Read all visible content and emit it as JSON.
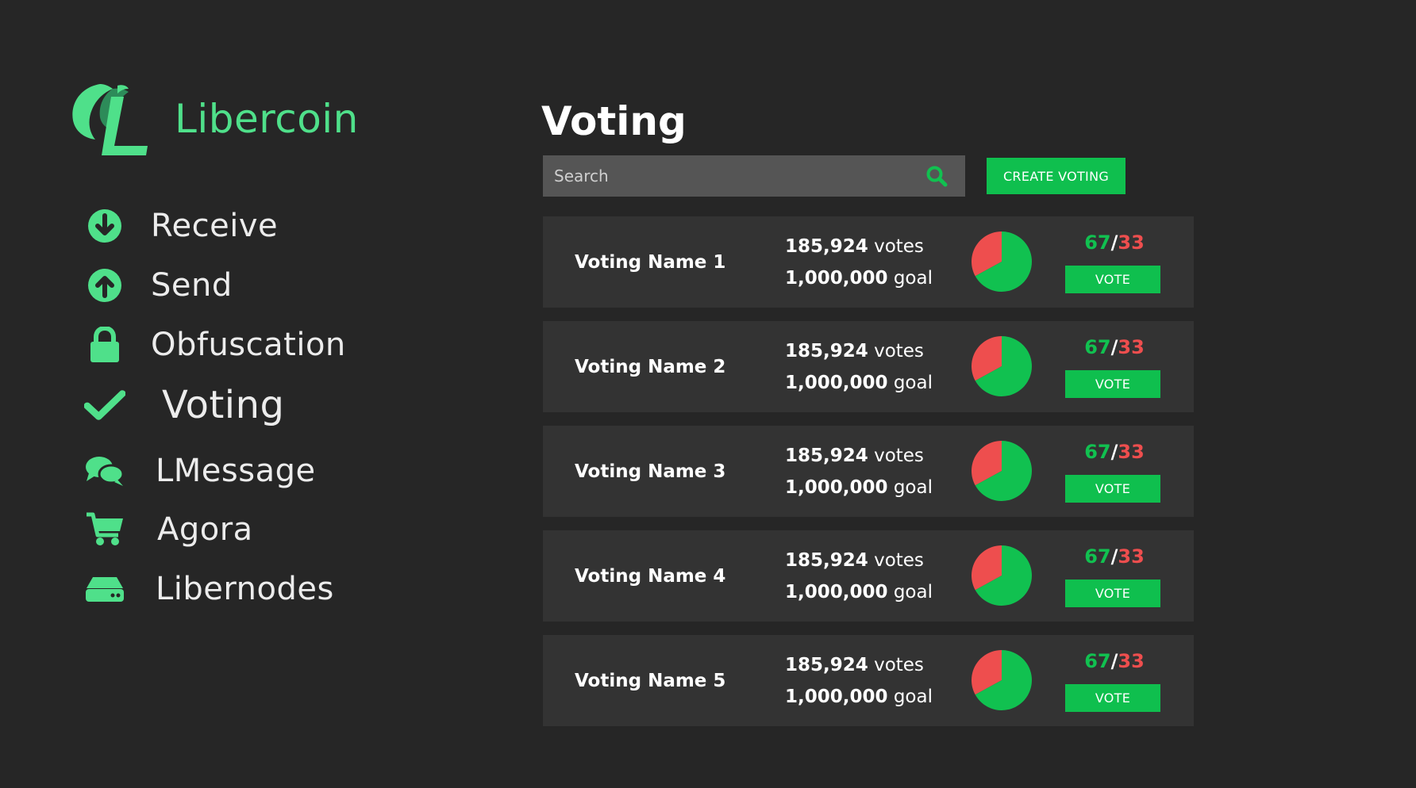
{
  "brand": {
    "name": "Libercoin",
    "logo_icon": "libercoin-logo",
    "color": "#4fe08a"
  },
  "sidebar": {
    "active": "Voting",
    "items": [
      {
        "label": "Receive",
        "icon": "arrow-down-circle-icon"
      },
      {
        "label": "Send",
        "icon": "arrow-up-circle-icon"
      },
      {
        "label": "Obfuscation",
        "icon": "lock-icon"
      },
      {
        "label": "Voting",
        "icon": "checkmark-icon"
      },
      {
        "label": "LMessage",
        "icon": "chat-bubbles-icon"
      },
      {
        "label": "Agora",
        "icon": "shopping-cart-icon"
      },
      {
        "label": "Libernodes",
        "icon": "server-drive-icon"
      }
    ]
  },
  "main": {
    "title": "Voting",
    "search": {
      "placeholder": "Search",
      "value": ""
    },
    "create_button": "CREATE VOTING",
    "votes": [
      {
        "name": "Voting Name 1",
        "votes": "185,924",
        "votes_unit": "votes",
        "goal": "1,000,000",
        "goal_unit": "goal",
        "yes": 67,
        "no": 33,
        "button": "VOTE"
      },
      {
        "name": "Voting Name 2",
        "votes": "185,924",
        "votes_unit": "votes",
        "goal": "1,000,000",
        "goal_unit": "goal",
        "yes": 67,
        "no": 33,
        "button": "VOTE"
      },
      {
        "name": "Voting Name 3",
        "votes": "185,924",
        "votes_unit": "votes",
        "goal": "1,000,000",
        "goal_unit": "goal",
        "yes": 67,
        "no": 33,
        "button": "VOTE"
      },
      {
        "name": "Voting Name 4",
        "votes": "185,924",
        "votes_unit": "votes",
        "goal": "1,000,000",
        "goal_unit": "goal",
        "yes": 67,
        "no": 33,
        "button": "VOTE"
      },
      {
        "name": "Voting Name 5",
        "votes": "185,924",
        "votes_unit": "votes",
        "goal": "1,000,000",
        "goal_unit": "goal",
        "yes": 67,
        "no": 33,
        "button": "VOTE"
      }
    ]
  },
  "colors": {
    "background": "#262626",
    "row_background": "#333333",
    "accent": "#0fbf4e",
    "nav_icon": "#4fe08a",
    "yes": "#11c150",
    "no": "#ee4e4e"
  }
}
